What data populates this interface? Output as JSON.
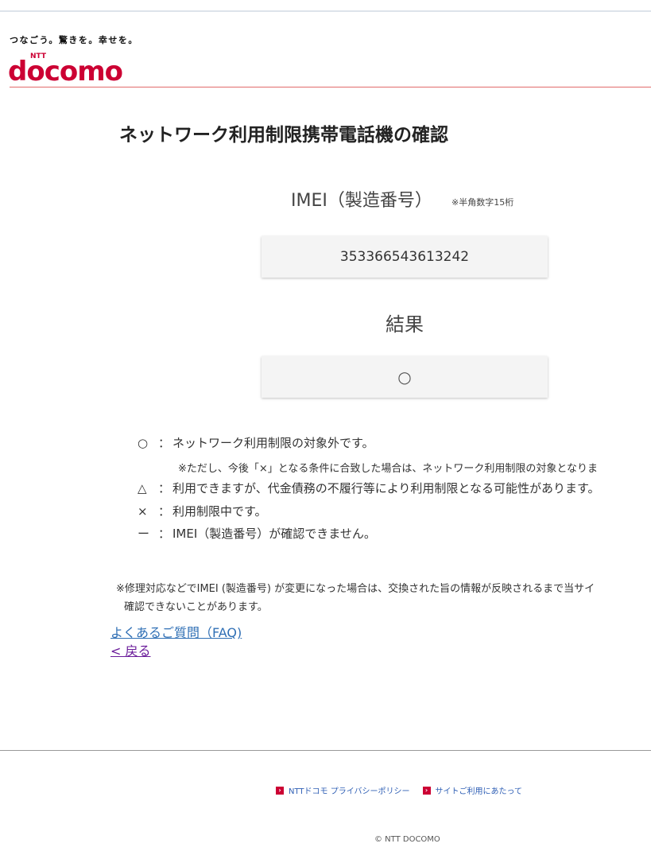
{
  "header": {
    "tagline": "つなごう。驚きを。幸せを。",
    "logo_ntt": "NTT",
    "logo_text": "docomo"
  },
  "page": {
    "title": "ネットワーク利用制限携帯電話機の確認"
  },
  "form": {
    "imei_label": "IMEI（製造番号）",
    "imei_note": "※半角数字15桁",
    "imei_value": "353366543613242",
    "result_label": "結果",
    "result_value": "○"
  },
  "legend": {
    "items": [
      {
        "symbol": "○",
        "colon": "：",
        "text": "ネットワーク利用制限の対象外です。"
      },
      {
        "symbol": "△",
        "colon": "：",
        "text": "利用できますが、代金債務の不履行等により利用制限となる可能性があります。"
      },
      {
        "symbol": "×",
        "colon": "：",
        "text": "利用制限中です。"
      },
      {
        "symbol": "ー",
        "colon": "：",
        "text": "IMEI（製造番号）が確認できません。"
      }
    ],
    "note": "※ただし、今後「×」となる条件に合致した場合は、ネットワーク利用制限の対象となりま"
  },
  "footnote": {
    "line1": "※修理対応などでIMEI (製造番号) が変更になった場合は、交換された旨の情報が反映されるまで当サイ",
    "line2": "確認できないことがあります。"
  },
  "links": {
    "faq": "よくあるご質問（FAQ)",
    "back": "< 戻る"
  },
  "footer": {
    "privacy": "NTTドコモ プライバシーポリシー",
    "site_terms": "サイトご利用にあたって",
    "copyright": "© NTT DOCOMO"
  }
}
